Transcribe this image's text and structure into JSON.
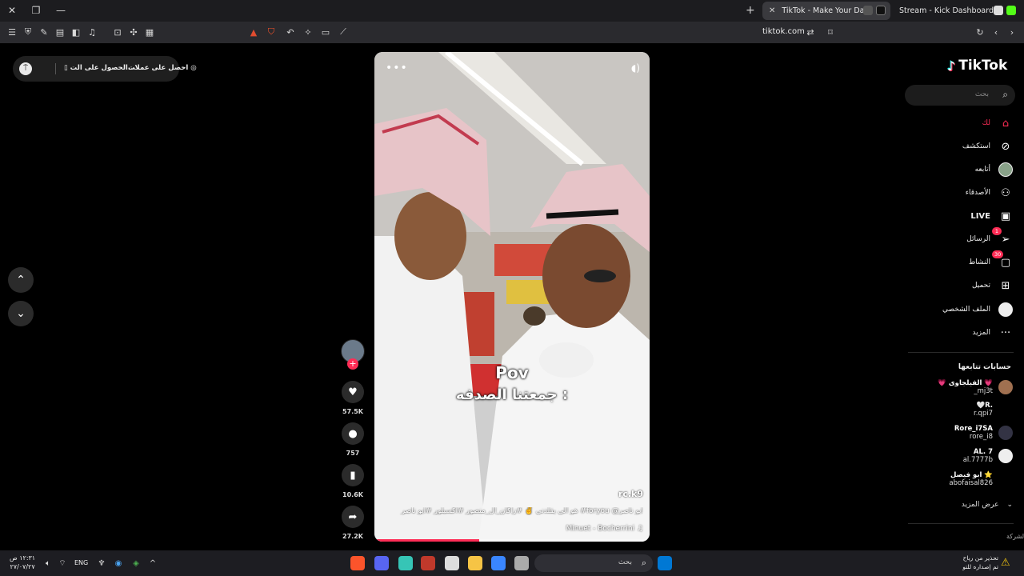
{
  "browser": {
    "tabs": [
      {
        "title": "TikTok - Make Your Day",
        "active": true
      },
      {
        "title": "Stream - Kick Dashboard",
        "active": false
      }
    ],
    "url": "tiktok.com"
  },
  "banner": {
    "get_coins": "احصل على عملات",
    "get_app": "الحصول على الت..."
  },
  "video": {
    "caption_line1": "Pov",
    "caption_line2": "جمعتنا الصدفه :",
    "author": "rc.k9",
    "description": "هو الي يقلدني  ✌️  #زاكان_ال_منصور #اكسبلور #ابو ناصر #foryou @ابو ناصر",
    "music": "Minuet - Bocherrini",
    "progress": 0.38
  },
  "actions": {
    "likes": "57.5K",
    "comments": "757",
    "saves": "10.6K",
    "shares": "27.2K"
  },
  "sidebar": {
    "logo": "TikTok",
    "search_placeholder": "بحث",
    "nav": [
      {
        "label": "لك",
        "icon": "home-icon"
      },
      {
        "label": "استكشف",
        "icon": "compass-icon"
      },
      {
        "label": "أتابعه",
        "icon": "avatar-icon"
      },
      {
        "label": "الأصدقاء",
        "icon": "friends-icon"
      },
      {
        "label": "LIVE",
        "icon": "live-icon"
      },
      {
        "label": "الرسائل",
        "icon": "messages-icon",
        "badge": "1"
      },
      {
        "label": "النشاط",
        "icon": "activity-icon",
        "badge": "30"
      },
      {
        "label": "تحميل",
        "icon": "upload-icon"
      },
      {
        "label": "الملف الشخصي",
        "icon": "profile-icon"
      },
      {
        "label": "المزيد",
        "icon": "more-icon"
      }
    ],
    "following_title": "حسابات تتابعها",
    "following": [
      {
        "name": "💗 الفيلجاوى 💗",
        "handle": "_mj3t"
      },
      {
        "name": "🤍R.",
        "handle": "r.qpi7"
      },
      {
        "name": "Rore_i7SA",
        "handle": "rore_i8"
      },
      {
        "name": "AL. 7",
        "handle": "al.7777b"
      },
      {
        "name": "ابو فيصل ⭐",
        "handle": "abofaisal826"
      }
    ],
    "see_more": "عرض المزيد",
    "footer": "الشركة"
  },
  "taskbar": {
    "time": "١٢:٣١ ص",
    "date": "٢٧/٠٧/٢٧",
    "lang": "ENG",
    "search_placeholder": "بحث",
    "update_line1": "تحذير من رياح",
    "update_line2": "تم إصداره للتو"
  },
  "colors": {
    "accent": "#fe2c55",
    "background": "#000000",
    "chrome": "#2a2a2e"
  }
}
